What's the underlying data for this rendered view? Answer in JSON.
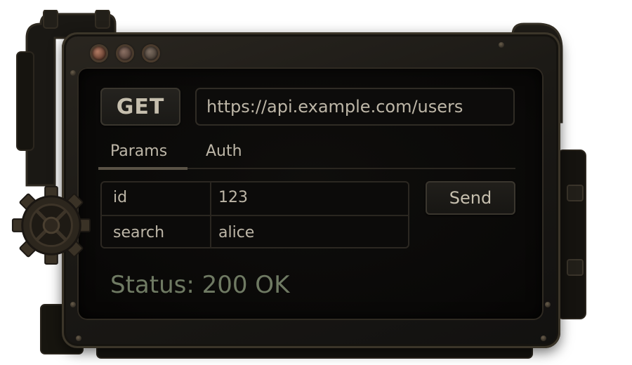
{
  "request": {
    "method": "GET",
    "url": "https://api.example.com/users"
  },
  "tabs": [
    {
      "label": "Params",
      "active": true
    },
    {
      "label": "Auth",
      "active": false
    }
  ],
  "params": [
    {
      "key": "id",
      "value": "123"
    },
    {
      "key": "search",
      "value": "alice"
    }
  ],
  "actions": {
    "send_label": "Send"
  },
  "response": {
    "status_text": "Status: 200 OK"
  },
  "icons": {
    "window_lights": [
      "red-light-icon",
      "brown-light-icon",
      "brown-light-icon"
    ],
    "decoration": "gear-icon"
  },
  "colors": {
    "screen_background": "#0a0908",
    "text": "#bdb6a7",
    "status_text": "#6f7a63",
    "frame": "#1b1915"
  }
}
